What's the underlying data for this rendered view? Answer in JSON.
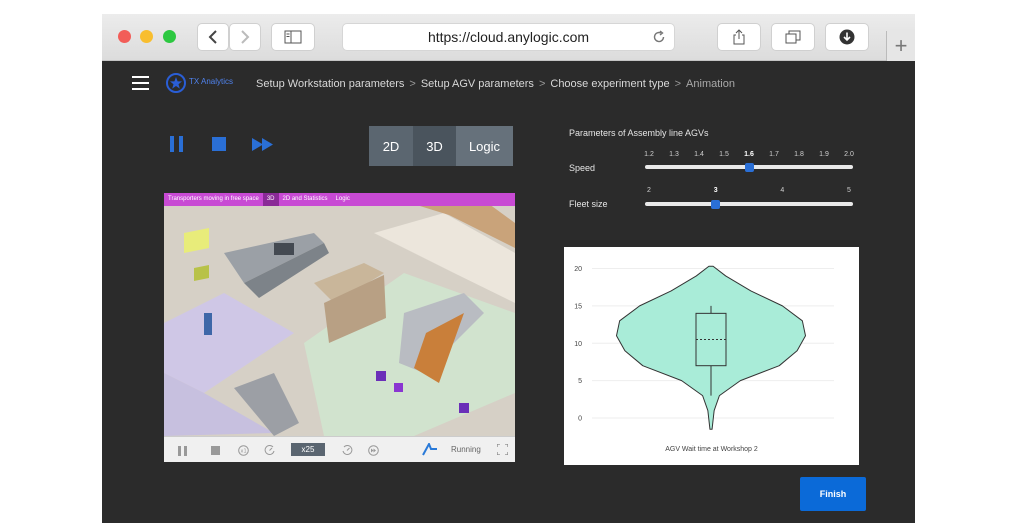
{
  "browser": {
    "url": "https://cloud.anylogic.com"
  },
  "header": {
    "brand": "TX Analytics",
    "breadcrumbs": [
      "Setup Workstation parameters",
      "Setup AGV parameters",
      "Choose experiment type",
      "Animation"
    ]
  },
  "view_toggle": [
    "2D",
    "3D",
    "Logic"
  ],
  "simulation": {
    "tabs": [
      "Transporters moving in free space",
      "3D",
      "2D and Statistics",
      "Logic"
    ],
    "speed_badge": "x25",
    "status": "Running"
  },
  "parameters": {
    "title": "Parameters of Assembly line AGVs",
    "speed": {
      "label": "Speed",
      "ticks": [
        "1.2",
        "1.3",
        "1.4",
        "1.5",
        "1.6",
        "1.7",
        "1.8",
        "1.9",
        "2.0"
      ],
      "value": 1.6,
      "selected": "1.6"
    },
    "fleet": {
      "label": "Fleet size",
      "ticks": [
        "2",
        "3",
        "4",
        "5"
      ],
      "value": 3,
      "selected": "3"
    }
  },
  "chart_data": {
    "type": "violin",
    "xlabel": "AGV Wait time at Workshop 2",
    "ylim": [
      -2,
      21
    ],
    "yticks": [
      0,
      5,
      10,
      15,
      20
    ],
    "box": {
      "min": 3,
      "q1": 7,
      "median": 10.5,
      "q3": 14,
      "max": 15
    },
    "violin_profile": [
      {
        "y": -1.5,
        "w": 0.1
      },
      {
        "y": 1,
        "w": 0.3
      },
      {
        "y": 3,
        "w": 0.8
      },
      {
        "y": 5,
        "w": 2.8
      },
      {
        "y": 7,
        "w": 6.5
      },
      {
        "y": 9,
        "w": 8.2
      },
      {
        "y": 11,
        "w": 9.0
      },
      {
        "y": 13,
        "w": 8.7
      },
      {
        "y": 15,
        "w": 6.8
      },
      {
        "y": 17,
        "w": 3.8
      },
      {
        "y": 19,
        "w": 1.4
      },
      {
        "y": 20.3,
        "w": 0.2
      }
    ],
    "fill_color": "#a9ecd8",
    "grid": true
  },
  "actions": {
    "finish": "Finish"
  }
}
